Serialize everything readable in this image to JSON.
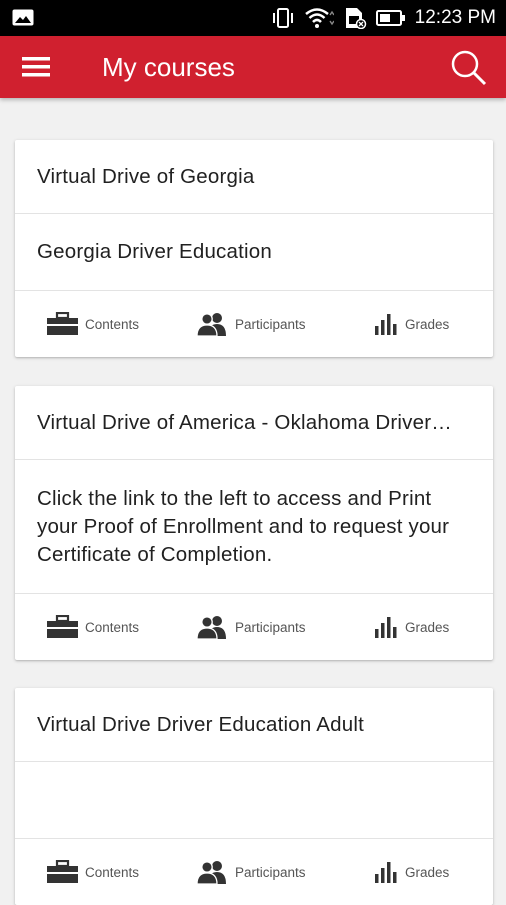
{
  "status_bar": {
    "time": "12:23 PM",
    "icons": [
      "image-icon",
      "vibrate-icon",
      "wifi-icon",
      "sim-icon",
      "battery-icon"
    ]
  },
  "app_bar": {
    "title": "My courses",
    "menu_icon": "hamburger-menu-icon",
    "search_icon": "search-icon",
    "color": "#d0202f"
  },
  "courses": [
    {
      "title": "Virtual Drive of Georgia",
      "summary": "Georgia Driver Education",
      "actions": {
        "contents": "Contents",
        "participants": "Participants",
        "grades": "Grades"
      }
    },
    {
      "title": "Virtual Drive of America - Oklahoma Driver…",
      "summary": "Click the link to the left to access and Print your Proof of Enrollment and to request your Certificate of Completion.",
      "actions": {
        "contents": "Contents",
        "participants": "Participants",
        "grades": "Grades"
      }
    },
    {
      "title": "Virtual Drive Driver Education Adult",
      "summary": "",
      "actions": {
        "contents": "Contents",
        "participants": "Participants",
        "grades": "Grades"
      }
    }
  ]
}
